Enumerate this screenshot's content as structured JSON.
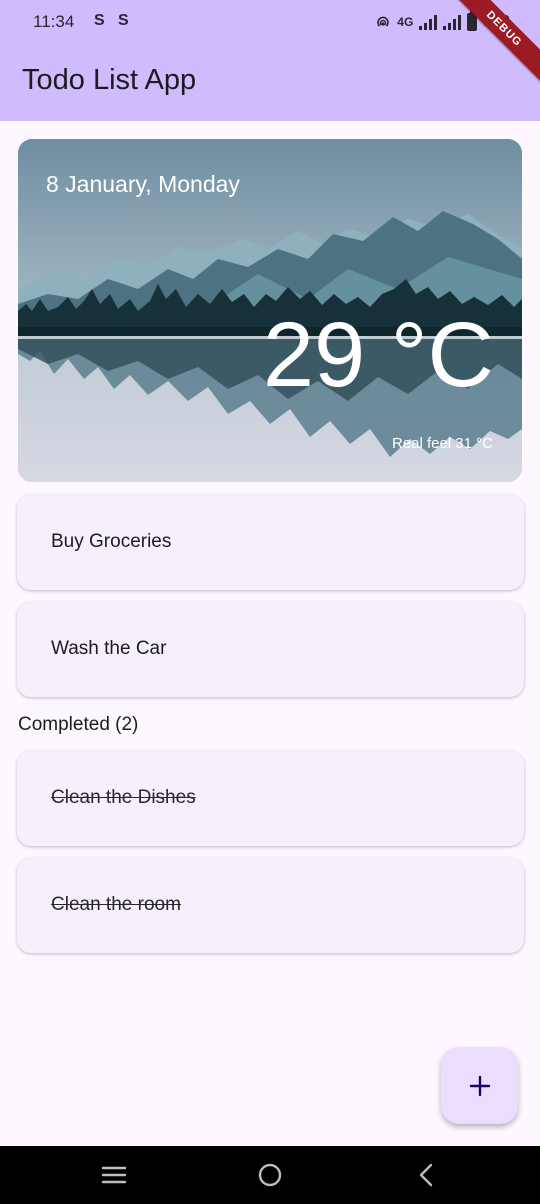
{
  "status_bar": {
    "time": "11:34",
    "icons": [
      "s-app-icon",
      "s-app-icon",
      "hotspot-icon",
      "4g-icon",
      "signal-icon",
      "signal-icon",
      "battery-icon"
    ],
    "network": "4G",
    "battery_text": "100"
  },
  "debug_banner": "DEBUG",
  "app_bar": {
    "title": "Todo List App"
  },
  "weather": {
    "date": "8 January, Monday",
    "temperature": "29 °C",
    "real_feel": "Real feel 31 °C"
  },
  "todos": [
    {
      "label": "Buy Groceries",
      "completed": false
    },
    {
      "label": "Wash the Car",
      "completed": false
    }
  ],
  "completed_section": {
    "label": "Completed (2)",
    "items": [
      {
        "label": "Clean the Dishes",
        "completed": true
      },
      {
        "label": "Clean the room",
        "completed": true
      }
    ]
  },
  "fab": {
    "icon": "plus-icon"
  },
  "nav_bar": {
    "icons": [
      "recent-apps-icon",
      "home-icon",
      "back-icon"
    ]
  },
  "colors": {
    "app_bar": "#cfbcff",
    "background": "#fef7ff",
    "card": "#f6f0fa",
    "fab": "#eaddff",
    "fab_icon": "#21005d"
  }
}
